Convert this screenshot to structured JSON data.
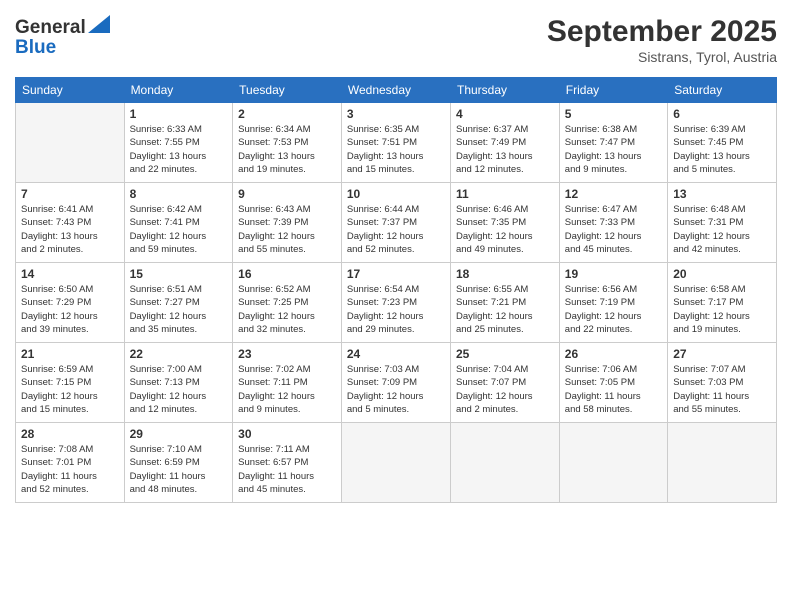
{
  "header": {
    "logo_general": "General",
    "logo_blue": "Blue",
    "month_title": "September 2025",
    "location": "Sistrans, Tyrol, Austria"
  },
  "columns": [
    "Sunday",
    "Monday",
    "Tuesday",
    "Wednesday",
    "Thursday",
    "Friday",
    "Saturday"
  ],
  "weeks": [
    [
      {
        "day": "",
        "info": ""
      },
      {
        "day": "1",
        "info": "Sunrise: 6:33 AM\nSunset: 7:55 PM\nDaylight: 13 hours\nand 22 minutes."
      },
      {
        "day": "2",
        "info": "Sunrise: 6:34 AM\nSunset: 7:53 PM\nDaylight: 13 hours\nand 19 minutes."
      },
      {
        "day": "3",
        "info": "Sunrise: 6:35 AM\nSunset: 7:51 PM\nDaylight: 13 hours\nand 15 minutes."
      },
      {
        "day": "4",
        "info": "Sunrise: 6:37 AM\nSunset: 7:49 PM\nDaylight: 13 hours\nand 12 minutes."
      },
      {
        "day": "5",
        "info": "Sunrise: 6:38 AM\nSunset: 7:47 PM\nDaylight: 13 hours\nand 9 minutes."
      },
      {
        "day": "6",
        "info": "Sunrise: 6:39 AM\nSunset: 7:45 PM\nDaylight: 13 hours\nand 5 minutes."
      }
    ],
    [
      {
        "day": "7",
        "info": "Sunrise: 6:41 AM\nSunset: 7:43 PM\nDaylight: 13 hours\nand 2 minutes."
      },
      {
        "day": "8",
        "info": "Sunrise: 6:42 AM\nSunset: 7:41 PM\nDaylight: 12 hours\nand 59 minutes."
      },
      {
        "day": "9",
        "info": "Sunrise: 6:43 AM\nSunset: 7:39 PM\nDaylight: 12 hours\nand 55 minutes."
      },
      {
        "day": "10",
        "info": "Sunrise: 6:44 AM\nSunset: 7:37 PM\nDaylight: 12 hours\nand 52 minutes."
      },
      {
        "day": "11",
        "info": "Sunrise: 6:46 AM\nSunset: 7:35 PM\nDaylight: 12 hours\nand 49 minutes."
      },
      {
        "day": "12",
        "info": "Sunrise: 6:47 AM\nSunset: 7:33 PM\nDaylight: 12 hours\nand 45 minutes."
      },
      {
        "day": "13",
        "info": "Sunrise: 6:48 AM\nSunset: 7:31 PM\nDaylight: 12 hours\nand 42 minutes."
      }
    ],
    [
      {
        "day": "14",
        "info": "Sunrise: 6:50 AM\nSunset: 7:29 PM\nDaylight: 12 hours\nand 39 minutes."
      },
      {
        "day": "15",
        "info": "Sunrise: 6:51 AM\nSunset: 7:27 PM\nDaylight: 12 hours\nand 35 minutes."
      },
      {
        "day": "16",
        "info": "Sunrise: 6:52 AM\nSunset: 7:25 PM\nDaylight: 12 hours\nand 32 minutes."
      },
      {
        "day": "17",
        "info": "Sunrise: 6:54 AM\nSunset: 7:23 PM\nDaylight: 12 hours\nand 29 minutes."
      },
      {
        "day": "18",
        "info": "Sunrise: 6:55 AM\nSunset: 7:21 PM\nDaylight: 12 hours\nand 25 minutes."
      },
      {
        "day": "19",
        "info": "Sunrise: 6:56 AM\nSunset: 7:19 PM\nDaylight: 12 hours\nand 22 minutes."
      },
      {
        "day": "20",
        "info": "Sunrise: 6:58 AM\nSunset: 7:17 PM\nDaylight: 12 hours\nand 19 minutes."
      }
    ],
    [
      {
        "day": "21",
        "info": "Sunrise: 6:59 AM\nSunset: 7:15 PM\nDaylight: 12 hours\nand 15 minutes."
      },
      {
        "day": "22",
        "info": "Sunrise: 7:00 AM\nSunset: 7:13 PM\nDaylight: 12 hours\nand 12 minutes."
      },
      {
        "day": "23",
        "info": "Sunrise: 7:02 AM\nSunset: 7:11 PM\nDaylight: 12 hours\nand 9 minutes."
      },
      {
        "day": "24",
        "info": "Sunrise: 7:03 AM\nSunset: 7:09 PM\nDaylight: 12 hours\nand 5 minutes."
      },
      {
        "day": "25",
        "info": "Sunrise: 7:04 AM\nSunset: 7:07 PM\nDaylight: 12 hours\nand 2 minutes."
      },
      {
        "day": "26",
        "info": "Sunrise: 7:06 AM\nSunset: 7:05 PM\nDaylight: 11 hours\nand 58 minutes."
      },
      {
        "day": "27",
        "info": "Sunrise: 7:07 AM\nSunset: 7:03 PM\nDaylight: 11 hours\nand 55 minutes."
      }
    ],
    [
      {
        "day": "28",
        "info": "Sunrise: 7:08 AM\nSunset: 7:01 PM\nDaylight: 11 hours\nand 52 minutes."
      },
      {
        "day": "29",
        "info": "Sunrise: 7:10 AM\nSunset: 6:59 PM\nDaylight: 11 hours\nand 48 minutes."
      },
      {
        "day": "30",
        "info": "Sunrise: 7:11 AM\nSunset: 6:57 PM\nDaylight: 11 hours\nand 45 minutes."
      },
      {
        "day": "",
        "info": ""
      },
      {
        "day": "",
        "info": ""
      },
      {
        "day": "",
        "info": ""
      },
      {
        "day": "",
        "info": ""
      }
    ]
  ]
}
